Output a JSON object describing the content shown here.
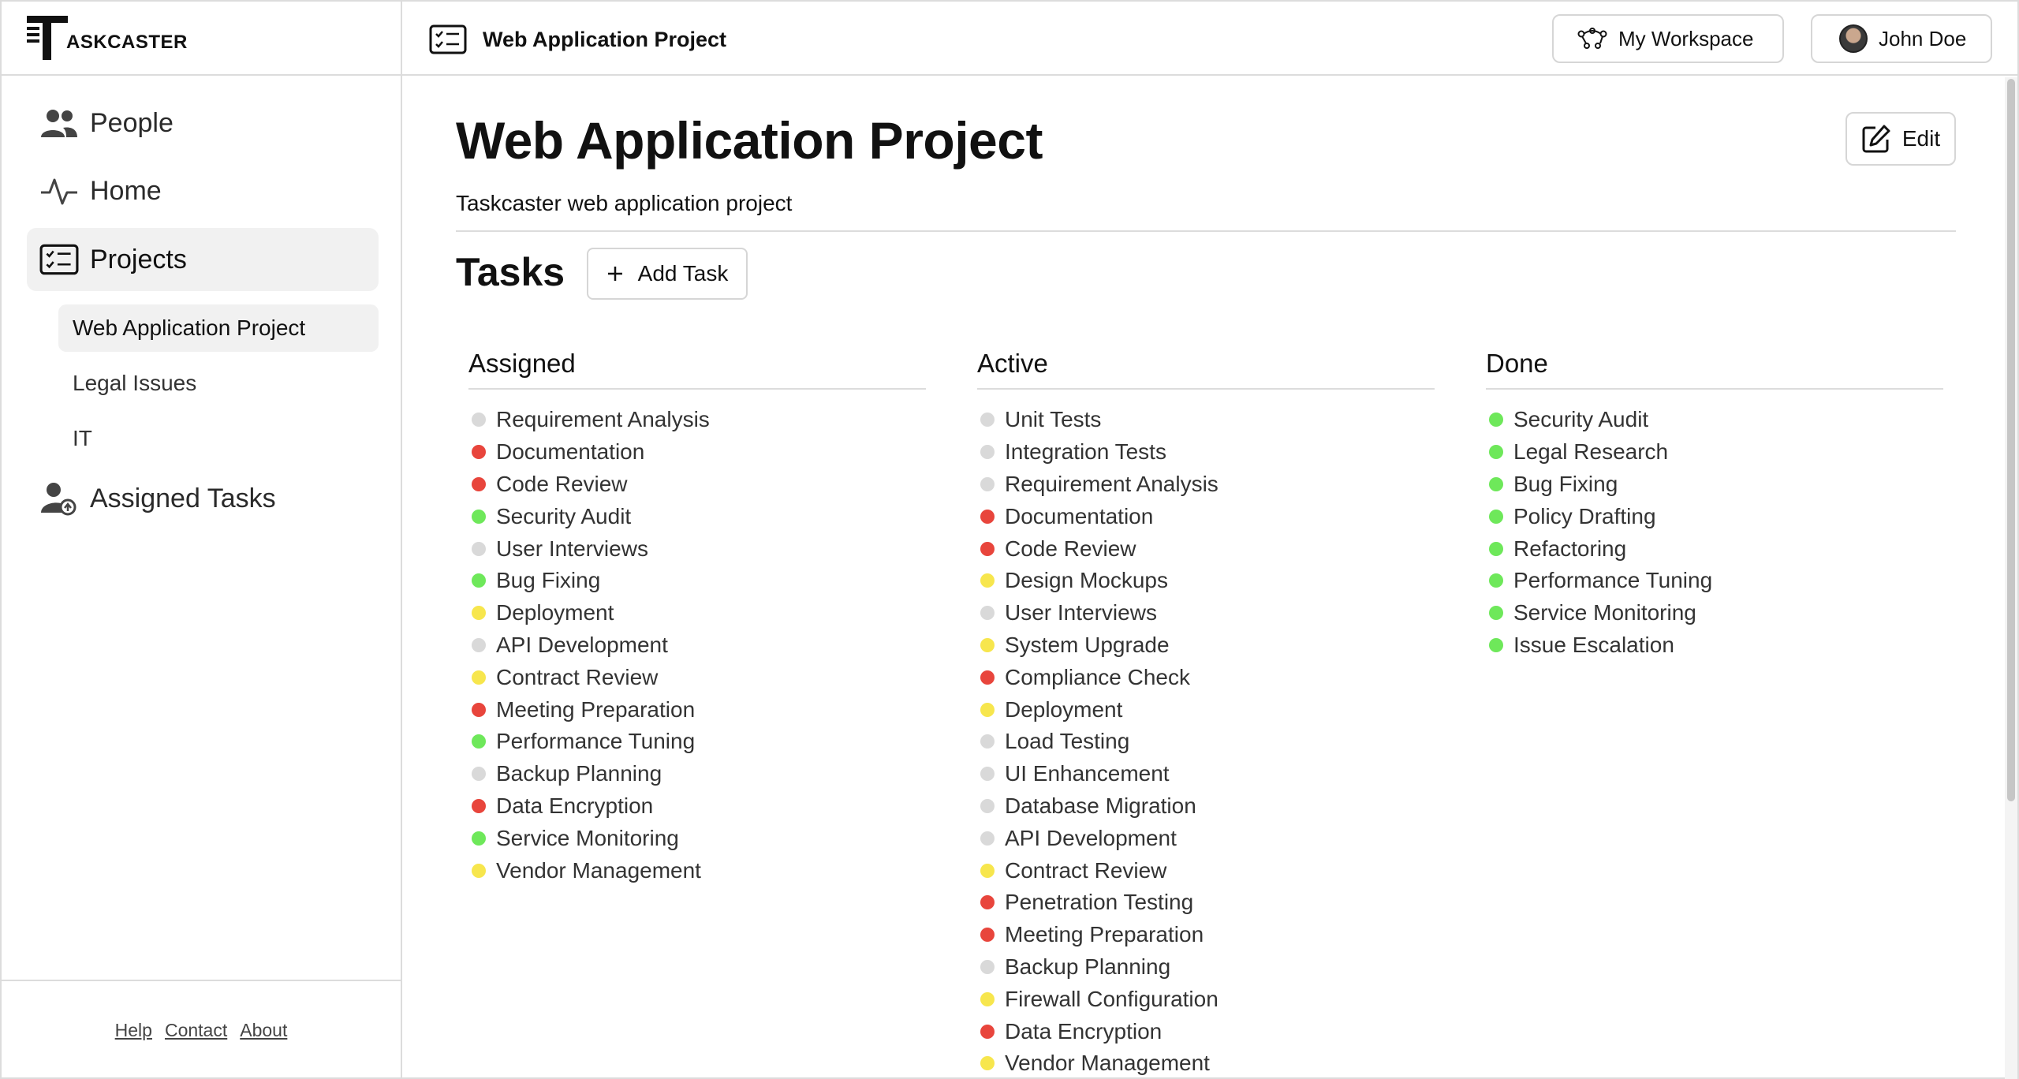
{
  "brand": {
    "wordmark": "ASKCASTER"
  },
  "header": {
    "project_title": "Web Application Project",
    "workspace_label": "My Workspace",
    "user_label": "John Doe"
  },
  "sidebar": {
    "nav": [
      {
        "label": "People",
        "icon": "people-icon"
      },
      {
        "label": "Home",
        "icon": "activity-icon"
      },
      {
        "label": "Projects",
        "icon": "checklist-icon"
      },
      {
        "label": "Assigned Tasks",
        "icon": "user-assign-icon"
      }
    ],
    "projects": [
      {
        "label": "Web Application Project",
        "selected": true
      },
      {
        "label": "Legal Issues",
        "selected": false
      },
      {
        "label": "IT",
        "selected": false
      }
    ],
    "footer": {
      "help": "Help",
      "contact": "Contact",
      "about": "About"
    }
  },
  "main": {
    "title": "Web Application Project",
    "description": "Taskcaster web application project",
    "edit_label": "Edit",
    "tasks_heading": "Tasks",
    "add_task_label": "Add Task"
  },
  "colors": {
    "grey": "#d9d9d9",
    "red": "#e8453c",
    "green": "#6ee85a",
    "yellow": "#f7e64d"
  },
  "columns": [
    {
      "title": "Assigned",
      "tasks": [
        {
          "name": "Requirement Analysis",
          "status": "grey"
        },
        {
          "name": "Documentation",
          "status": "red"
        },
        {
          "name": "Code Review",
          "status": "red"
        },
        {
          "name": "Security Audit",
          "status": "green"
        },
        {
          "name": "User Interviews",
          "status": "grey"
        },
        {
          "name": "Bug Fixing",
          "status": "green"
        },
        {
          "name": "Deployment",
          "status": "yellow"
        },
        {
          "name": "API Development",
          "status": "grey"
        },
        {
          "name": "Contract Review",
          "status": "yellow"
        },
        {
          "name": "Meeting Preparation",
          "status": "red"
        },
        {
          "name": "Performance Tuning",
          "status": "green"
        },
        {
          "name": "Backup Planning",
          "status": "grey"
        },
        {
          "name": "Data Encryption",
          "status": "red"
        },
        {
          "name": "Service Monitoring",
          "status": "green"
        },
        {
          "name": "Vendor Management",
          "status": "yellow"
        }
      ]
    },
    {
      "title": "Active",
      "tasks": [
        {
          "name": "Unit Tests",
          "status": "grey"
        },
        {
          "name": "Integration Tests",
          "status": "grey"
        },
        {
          "name": "Requirement Analysis",
          "status": "grey"
        },
        {
          "name": "Documentation",
          "status": "red"
        },
        {
          "name": "Code Review",
          "status": "red"
        },
        {
          "name": "Design Mockups",
          "status": "yellow"
        },
        {
          "name": "User Interviews",
          "status": "grey"
        },
        {
          "name": "System Upgrade",
          "status": "yellow"
        },
        {
          "name": "Compliance Check",
          "status": "red"
        },
        {
          "name": "Deployment",
          "status": "yellow"
        },
        {
          "name": "Load Testing",
          "status": "grey"
        },
        {
          "name": "UI Enhancement",
          "status": "grey"
        },
        {
          "name": "Database Migration",
          "status": "grey"
        },
        {
          "name": "API Development",
          "status": "grey"
        },
        {
          "name": "Contract Review",
          "status": "yellow"
        },
        {
          "name": "Penetration Testing",
          "status": "red"
        },
        {
          "name": "Meeting Preparation",
          "status": "red"
        },
        {
          "name": "Backup Planning",
          "status": "grey"
        },
        {
          "name": "Firewall Configuration",
          "status": "yellow"
        },
        {
          "name": "Data Encryption",
          "status": "red"
        },
        {
          "name": "Vendor Management",
          "status": "yellow"
        }
      ]
    },
    {
      "title": "Done",
      "tasks": [
        {
          "name": "Security Audit",
          "status": "green"
        },
        {
          "name": "Legal Research",
          "status": "green"
        },
        {
          "name": "Bug Fixing",
          "status": "green"
        },
        {
          "name": "Policy Drafting",
          "status": "green"
        },
        {
          "name": "Refactoring",
          "status": "green"
        },
        {
          "name": "Performance Tuning",
          "status": "green"
        },
        {
          "name": "Service Monitoring",
          "status": "green"
        },
        {
          "name": "Issue Escalation",
          "status": "green"
        }
      ]
    }
  ]
}
